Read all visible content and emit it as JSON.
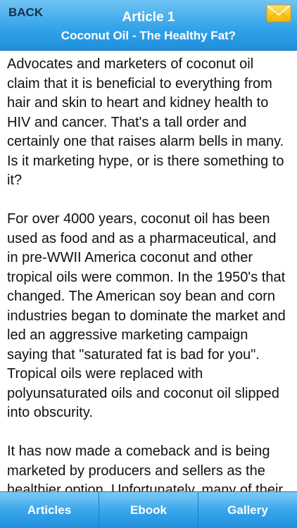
{
  "header": {
    "back_label": "BACK",
    "title": "Article 1",
    "subtitle": "Coconut Oil - The Healthy Fat?",
    "mail_icon": "envelope-icon"
  },
  "article": {
    "paragraphs": [
      "Advocates and marketers of coconut oil claim that it is beneficial to everything from hair and skin to heart and kidney health to HIV and cancer. That's a tall order and certainly one that raises alarm bells in many. Is it marketing hype, or is there something to it?",
      "For over 4000 years, coconut oil has been used as food and as a pharmaceutical, and in pre-WWII America coconut and other tropical oils were common. In the 1950's that changed. The American soy bean and corn industries began to dominate the market and led an aggressive marketing campaign saying that \"saturated fat is bad for you\". Tropical oils were replaced with polyunsaturated oils and coconut oil slipped into obscurity.",
      "It has now made a comeback and is being marketed by producers and sellers as the healthier option. Unfortunately, many of their"
    ]
  },
  "tabbar": {
    "articles_label": "Articles",
    "ebook_label": "Ebook",
    "gallery_label": "Gallery"
  },
  "colors": {
    "header_blue": "#35a4ea",
    "tab_blue": "#3aa7eb",
    "back_text": "#1c2e44",
    "envelope_yellow": "#f6c21c"
  }
}
